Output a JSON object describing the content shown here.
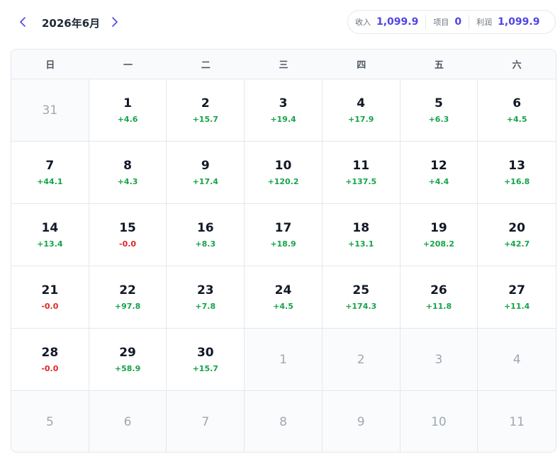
{
  "header": {
    "title": "2026年6月",
    "prev_icon": "chevron-left-icon",
    "next_icon": "chevron-right-icon"
  },
  "summary": [
    {
      "label": "收入",
      "value": "1,099.9"
    },
    {
      "label": "项目",
      "value": "0"
    },
    {
      "label": "利润",
      "value": "1,099.9"
    }
  ],
  "weekdays": [
    "日",
    "一",
    "二",
    "三",
    "四",
    "五",
    "六"
  ],
  "colors": {
    "accent": "#4f46e5",
    "positive": "#16a34a",
    "negative": "#dc2626"
  },
  "days": [
    {
      "day": "31",
      "profit": "",
      "current": false
    },
    {
      "day": "1",
      "profit": "+4.6",
      "current": true
    },
    {
      "day": "2",
      "profit": "+15.7",
      "current": true
    },
    {
      "day": "3",
      "profit": "+19.4",
      "current": true
    },
    {
      "day": "4",
      "profit": "+17.9",
      "current": true
    },
    {
      "day": "5",
      "profit": "+6.3",
      "current": true
    },
    {
      "day": "6",
      "profit": "+4.5",
      "current": true
    },
    {
      "day": "7",
      "profit": "+44.1",
      "current": true
    },
    {
      "day": "8",
      "profit": "+4.3",
      "current": true
    },
    {
      "day": "9",
      "profit": "+17.4",
      "current": true
    },
    {
      "day": "10",
      "profit": "+120.2",
      "current": true
    },
    {
      "day": "11",
      "profit": "+137.5",
      "current": true
    },
    {
      "day": "12",
      "profit": "+4.4",
      "current": true
    },
    {
      "day": "13",
      "profit": "+16.8",
      "current": true
    },
    {
      "day": "14",
      "profit": "+13.4",
      "current": true
    },
    {
      "day": "15",
      "profit": "-0.0",
      "current": true
    },
    {
      "day": "16",
      "profit": "+8.3",
      "current": true
    },
    {
      "day": "17",
      "profit": "+18.9",
      "current": true
    },
    {
      "day": "18",
      "profit": "+13.1",
      "current": true
    },
    {
      "day": "19",
      "profit": "+208.2",
      "current": true
    },
    {
      "day": "20",
      "profit": "+42.7",
      "current": true
    },
    {
      "day": "21",
      "profit": "-0.0",
      "current": true
    },
    {
      "day": "22",
      "profit": "+97.8",
      "current": true
    },
    {
      "day": "23",
      "profit": "+7.8",
      "current": true
    },
    {
      "day": "24",
      "profit": "+4.5",
      "current": true
    },
    {
      "day": "25",
      "profit": "+174.3",
      "current": true
    },
    {
      "day": "26",
      "profit": "+11.8",
      "current": true
    },
    {
      "day": "27",
      "profit": "+11.4",
      "current": true
    },
    {
      "day": "28",
      "profit": "-0.0",
      "current": true
    },
    {
      "day": "29",
      "profit": "+58.9",
      "current": true
    },
    {
      "day": "30",
      "profit": "+15.7",
      "current": true
    },
    {
      "day": "1",
      "profit": "",
      "current": false
    },
    {
      "day": "2",
      "profit": "",
      "current": false
    },
    {
      "day": "3",
      "profit": "",
      "current": false
    },
    {
      "day": "4",
      "profit": "",
      "current": false
    },
    {
      "day": "5",
      "profit": "",
      "current": false
    },
    {
      "day": "6",
      "profit": "",
      "current": false
    },
    {
      "day": "7",
      "profit": "",
      "current": false
    },
    {
      "day": "8",
      "profit": "",
      "current": false
    },
    {
      "day": "9",
      "profit": "",
      "current": false
    },
    {
      "day": "10",
      "profit": "",
      "current": false
    },
    {
      "day": "11",
      "profit": "",
      "current": false
    }
  ]
}
